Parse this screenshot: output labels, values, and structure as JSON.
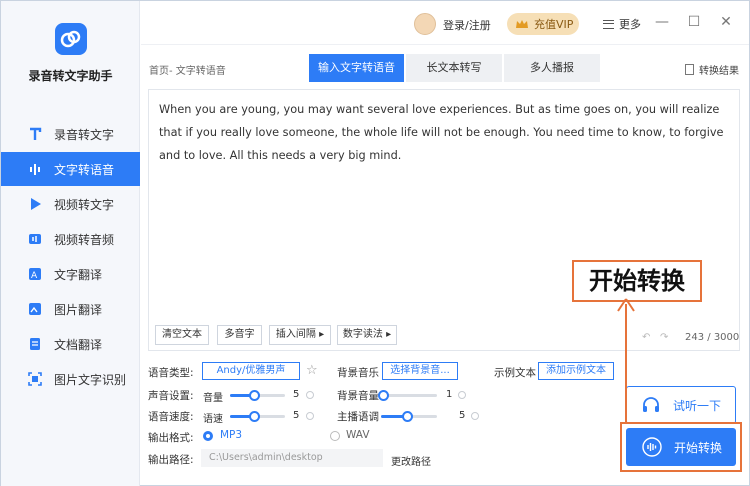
{
  "app": {
    "name": "录音转文字助手"
  },
  "sidebar": {
    "items": [
      {
        "label": "录音转文字",
        "icon": "text-icon",
        "active": false
      },
      {
        "label": "文字转语音",
        "icon": "audio-bars-icon",
        "active": true
      },
      {
        "label": "视频转文字",
        "icon": "play-icon",
        "active": false
      },
      {
        "label": "视频转音频",
        "icon": "video-audio-icon",
        "active": false
      },
      {
        "label": "文字翻译",
        "icon": "translate-icon",
        "active": false
      },
      {
        "label": "图片翻译",
        "icon": "image-translate-icon",
        "active": false
      },
      {
        "label": "文档翻译",
        "icon": "document-translate-icon",
        "active": false
      },
      {
        "label": "图片文字识别",
        "icon": "scan-icon",
        "active": false
      }
    ]
  },
  "titlebar": {
    "login": "登录/注册",
    "vip": "充值VIP",
    "more": "更多"
  },
  "breadcrumb": "首页- 文字转语音",
  "tabs": [
    "输入文字转语音",
    "长文本转写",
    "多人播报"
  ],
  "convert_result": "转换结果",
  "editor": {
    "text": "When you are young, you may want several love experiences. But as time goes on, you will realize that if you really love someone, the whole life will not be enough. You need time to know, to forgive and to love. All this needs a very big mind.",
    "tools": [
      "清空文本",
      "多音字",
      "插入间隔 ▸",
      "数字读法 ▸"
    ],
    "counter": "243 / 3000"
  },
  "settings": {
    "voice_type_label": "语音类型:",
    "voice_name": "Andy/优雅男声",
    "bgm_label": "背景音乐",
    "bgm_button": "选择背景音...",
    "sample_label": "示例文本",
    "sample_button": "添加示例文本",
    "sound_label": "声音设置:",
    "volume_label": "音量",
    "volume_value": "5",
    "bg_volume_label": "背景音量",
    "bg_volume_value": "1",
    "speed_label": "语音速度:",
    "speed_sub": "语速",
    "speed_value": "5",
    "tone_label": "主播语调",
    "tone_value": "5",
    "format_label": "输出格式:",
    "format_mp3": "MP3",
    "format_wav": "WAV",
    "path_label": "输出路径:",
    "path_value": "C:\\Users\\admin\\desktop",
    "change_path": "更改路径"
  },
  "actions": {
    "listen": "试听一下",
    "start": "开始转换"
  },
  "callout": "开始转换",
  "colors": {
    "accent": "#2d7cf6",
    "highlight": "#e6733a",
    "vip_bg": "#f6dfb6"
  }
}
